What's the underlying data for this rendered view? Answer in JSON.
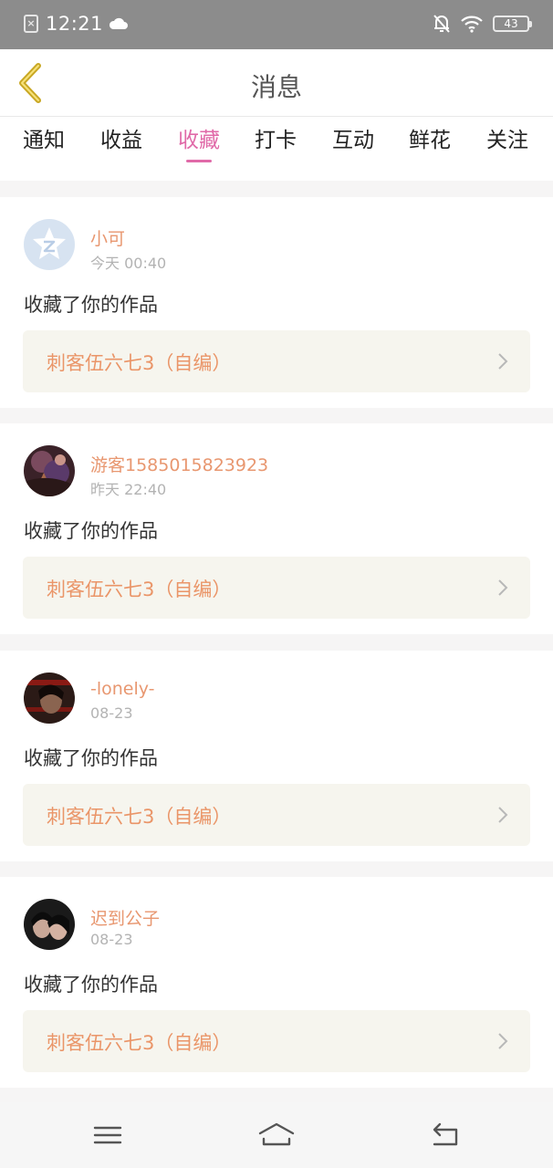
{
  "status_bar": {
    "time": "12:21",
    "battery": "43"
  },
  "header": {
    "title": "消息"
  },
  "tabs": [
    {
      "label": "通知"
    },
    {
      "label": "收益"
    },
    {
      "label": "收藏",
      "active": true
    },
    {
      "label": "打卡"
    },
    {
      "label": "互动"
    },
    {
      "label": "鲜花"
    },
    {
      "label": "关注"
    }
  ],
  "messages": [
    {
      "username": "小可",
      "time": "今天 00:40",
      "action": "收藏了你的作品",
      "work": "刺客伍六七3（自编）"
    },
    {
      "username": "游客1585015823923",
      "time": "昨天 22:40",
      "action": "收藏了你的作品",
      "work": "刺客伍六七3（自编）"
    },
    {
      "username": "-lonely-",
      "time": "08-23",
      "action": "收藏了你的作品",
      "work": "刺客伍六七3（自编）"
    },
    {
      "username": "迟到公子",
      "time": "08-23",
      "action": "收藏了你的作品",
      "work": "刺客伍六七3（自编）"
    }
  ],
  "colors": {
    "accent": "#e06aa8",
    "username": "#e89770",
    "work_link": "#ea9568",
    "back_arrow": "#c9a824"
  }
}
